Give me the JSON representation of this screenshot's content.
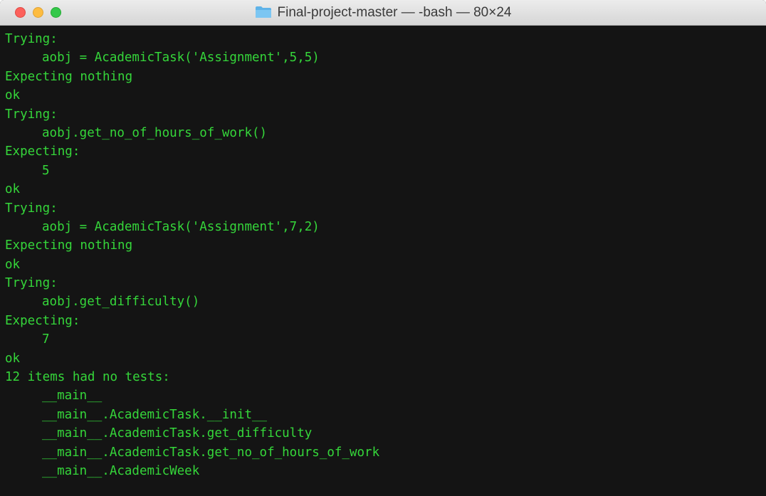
{
  "window": {
    "title": "Final-project-master — -bash — 80×24",
    "folder_icon": "folder-icon",
    "text_color": "#35d63a",
    "background_color": "#141414"
  },
  "terminal": {
    "lines": [
      "Trying:",
      "aobj = AcademicTask('Assignment',5,5)",
      "Expecting nothing",
      "ok",
      "Trying:",
      "aobj.get_no_of_hours_of_work()",
      "Expecting:",
      "5",
      "ok",
      "Trying:",
      "aobj = AcademicTask('Assignment',7,2)",
      "Expecting nothing",
      "ok",
      "Trying:",
      "aobj.get_difficulty()",
      "Expecting:",
      "7",
      "ok",
      "12 items had no tests:",
      "__main__",
      "__main__.AcademicTask.__init__",
      "__main__.AcademicTask.get_difficulty",
      "__main__.AcademicTask.get_no_of_hours_of_work",
      "__main__.AcademicWeek"
    ]
  }
}
